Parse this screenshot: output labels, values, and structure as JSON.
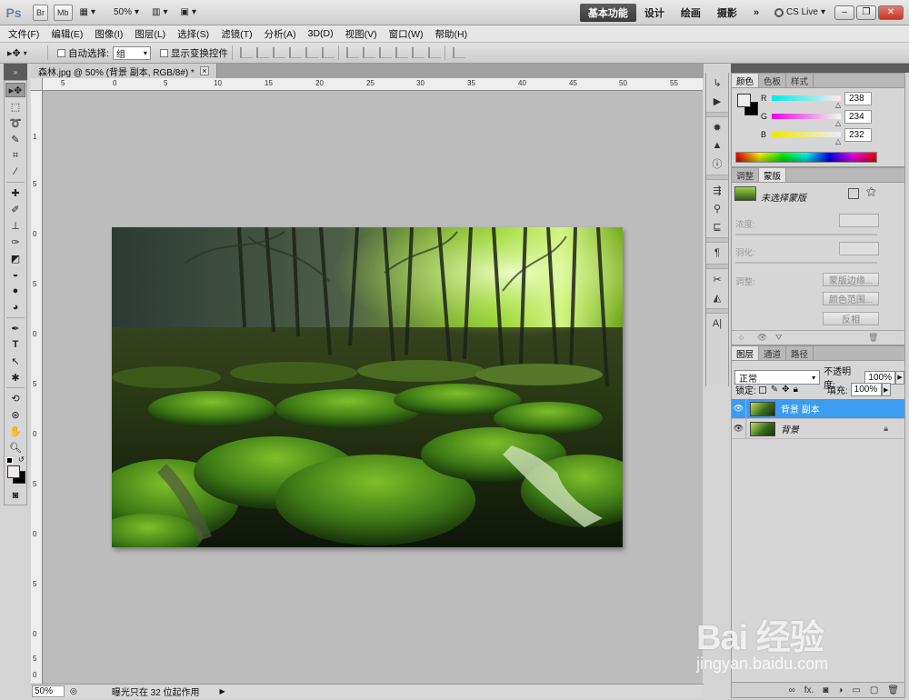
{
  "appbar": {
    "logo": "Ps",
    "br_label": "Br",
    "mb_label": "Mb",
    "zoom": "50%",
    "workspaces": [
      "基本功能",
      "设计",
      "绘画",
      "摄影"
    ],
    "more": "»",
    "cs_live": "CS Live"
  },
  "menu": [
    "文件(F)",
    "编辑(E)",
    "图像(I)",
    "图层(L)",
    "选择(S)",
    "滤镜(T)",
    "分析(A)",
    "3D(D)",
    "视图(V)",
    "窗口(W)",
    "帮助(H)"
  ],
  "options": {
    "auto_select_label": "自动选择:",
    "auto_select_value": "组",
    "show_transform_label": "显示变换控件"
  },
  "document": {
    "tab_title": "森林.jpg @ 50% (背景 副本, RGB/8#) *",
    "close": "×",
    "ruler_top": [
      "5",
      "0",
      "5",
      "10",
      "15",
      "20",
      "25",
      "30",
      "35",
      "40",
      "45",
      "50",
      "55"
    ],
    "ruler_left": [
      "1",
      "5",
      "0",
      "5",
      "0",
      "5",
      "0",
      "5",
      "0",
      "5",
      "0",
      "5",
      "0"
    ]
  },
  "status": {
    "zoom": "50%",
    "text": "曝光只在 32 位起作用"
  },
  "color_panel": {
    "tabs": [
      "颜色",
      "色板",
      "样式"
    ],
    "channels": [
      {
        "letter": "R",
        "value": "238",
        "gradient": "linear-gradient(to right,#00eaea,#ffeaea)"
      },
      {
        "letter": "G",
        "value": "234",
        "gradient": "linear-gradient(to right,#ee00e8,#eeffe8)"
      },
      {
        "letter": "B",
        "value": "232",
        "gradient": "linear-gradient(to right,#eeea00,#eeeaff)"
      }
    ]
  },
  "masks_panel": {
    "tabs": [
      "调整",
      "蒙版"
    ],
    "no_mask": "未选择蒙版",
    "density_label": "浓度:",
    "feather_label": "羽化:",
    "refine_label": "调整:",
    "btn_edge": "蒙版边缘...",
    "btn_range": "颜色范围...",
    "btn_invert": "反相"
  },
  "layers_panel": {
    "tabs": [
      "图层",
      "通道",
      "路径"
    ],
    "blend_mode": "正常",
    "opacity_label": "不透明度:",
    "opacity_value": "100%",
    "lock_label": "锁定:",
    "fill_label": "填充:",
    "fill_value": "100%",
    "layers": [
      {
        "name": "背景 副本",
        "selected": true
      },
      {
        "name": "背景",
        "selected": false
      }
    ],
    "footer_icons": [
      "∞",
      "fx.",
      "◙",
      "◑",
      "▭",
      "▢",
      "🗑"
    ]
  },
  "watermark": {
    "brand": "Bai 经验",
    "url": "jingyan.baidu.com"
  }
}
